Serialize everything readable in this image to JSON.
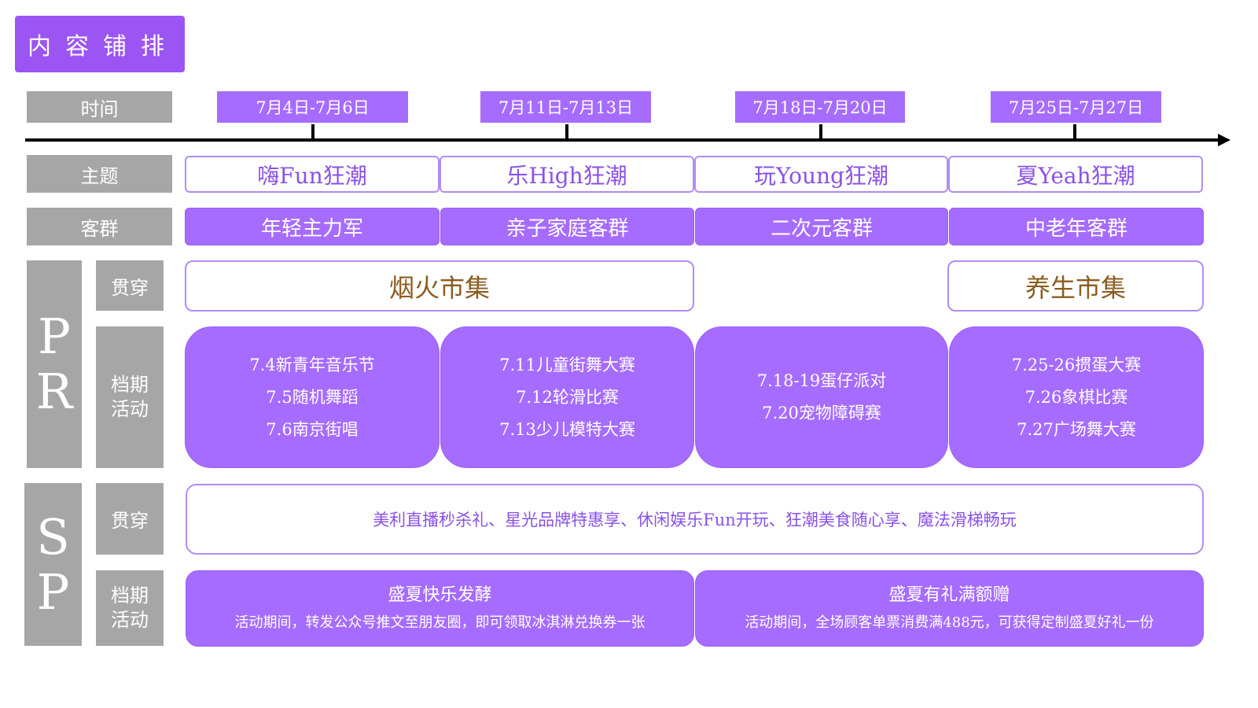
{
  "title": "内容铺排",
  "colors": {
    "accent": "#a66cff",
    "gray": "#a6a6a6",
    "market_text": "#8b5c20"
  },
  "row_labels": {
    "time": "时间",
    "theme": "主题",
    "group": "客群",
    "pr_letters": [
      "P",
      "R"
    ],
    "sp_letters": [
      "S",
      "P"
    ],
    "throughout": "贯穿",
    "schedule": "档期\n活动"
  },
  "dates": [
    "7月4日-7月6日",
    "7月11日-7月13日",
    "7月18日-7月20日",
    "7月25日-7月27日"
  ],
  "themes": [
    "嗨Fun狂潮",
    "乐High狂潮",
    "玩Young狂潮",
    "夏Yeah狂潮"
  ],
  "groups": [
    "年轻主力军",
    "亲子家庭客群",
    "二次元客群",
    "中老年客群"
  ],
  "pr": {
    "markets": [
      "烟火市集",
      "养生市集"
    ],
    "events": [
      [
        "7.4新青年音乐节",
        "7.5随机舞蹈",
        "7.6南京街唱"
      ],
      [
        "7.11儿童街舞大赛",
        "7.12轮滑比赛",
        "7.13少儿模特大赛"
      ],
      [
        "7.18-19蛋仔派对",
        "7.20宠物障碍赛"
      ],
      [
        "7.25-26掼蛋大赛",
        "7.26象棋比赛",
        "7.27广场舞大赛"
      ]
    ]
  },
  "sp": {
    "throughout": "美利直播秒杀礼、星光品牌特惠享、休闲娱乐Fun开玩、狂潮美食随心享、魔法滑梯畅玩",
    "promos": [
      {
        "title": "盛夏快乐发酵",
        "desc": "活动期间，转发公众号推文至朋友圈，即可领取冰淇淋兑换券一张"
      },
      {
        "title": "盛夏有礼满额赠",
        "desc": "活动期间，全场顾客单票消费满488元，可获得定制盛夏好礼一份"
      }
    ]
  }
}
